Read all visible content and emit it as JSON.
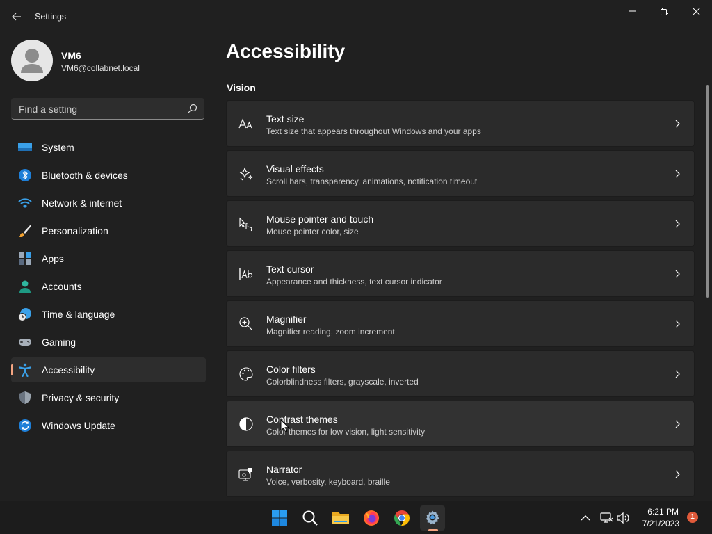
{
  "app": {
    "title": "Settings"
  },
  "user": {
    "name": "VM6",
    "email": "VM6@collabnet.local"
  },
  "search": {
    "placeholder": "Find a setting"
  },
  "sidebar": {
    "items": [
      {
        "label": "System",
        "icon": "monitor-icon"
      },
      {
        "label": "Bluetooth & devices",
        "icon": "bluetooth-icon"
      },
      {
        "label": "Network & internet",
        "icon": "wifi-icon"
      },
      {
        "label": "Personalization",
        "icon": "paintbrush-icon"
      },
      {
        "label": "Apps",
        "icon": "apps-icon"
      },
      {
        "label": "Accounts",
        "icon": "person-icon"
      },
      {
        "label": "Time & language",
        "icon": "globe-clock-icon"
      },
      {
        "label": "Gaming",
        "icon": "gamepad-icon"
      },
      {
        "label": "Accessibility",
        "icon": "accessibility-icon",
        "selected": true
      },
      {
        "label": "Privacy & security",
        "icon": "shield-icon"
      },
      {
        "label": "Windows Update",
        "icon": "update-icon"
      }
    ]
  },
  "main": {
    "title": "Accessibility",
    "section": "Vision",
    "cards": [
      {
        "title": "Text size",
        "subtitle": "Text size that appears throughout Windows and your apps",
        "icon": "text-size-icon"
      },
      {
        "title": "Visual effects",
        "subtitle": "Scroll bars, transparency, animations, notification timeout",
        "icon": "sparkle-icon"
      },
      {
        "title": "Mouse pointer and touch",
        "subtitle": "Mouse pointer color, size",
        "icon": "pointer-touch-icon"
      },
      {
        "title": "Text cursor",
        "subtitle": "Appearance and thickness, text cursor indicator",
        "icon": "text-cursor-icon"
      },
      {
        "title": "Magnifier",
        "subtitle": "Magnifier reading, zoom increment",
        "icon": "magnifier-icon"
      },
      {
        "title": "Color filters",
        "subtitle": "Colorblindness filters, grayscale, inverted",
        "icon": "palette-icon"
      },
      {
        "title": "Contrast themes",
        "subtitle": "Color themes for low vision, light sensitivity",
        "icon": "contrast-icon"
      },
      {
        "title": "Narrator",
        "subtitle": "Voice, verbosity, keyboard, braille",
        "icon": "narrator-icon"
      }
    ]
  },
  "taskbar": {
    "apps": [
      "start-icon",
      "search-icon",
      "file-explorer-icon",
      "firefox-icon",
      "chrome-icon",
      "settings-icon"
    ],
    "time": "6:21 PM",
    "date": "7/21/2023",
    "notification_count": "1"
  },
  "colors": {
    "background": "#202020",
    "card": "#2b2b2b",
    "accent": "#f4a582",
    "taskbar": "#1c1c1c"
  }
}
